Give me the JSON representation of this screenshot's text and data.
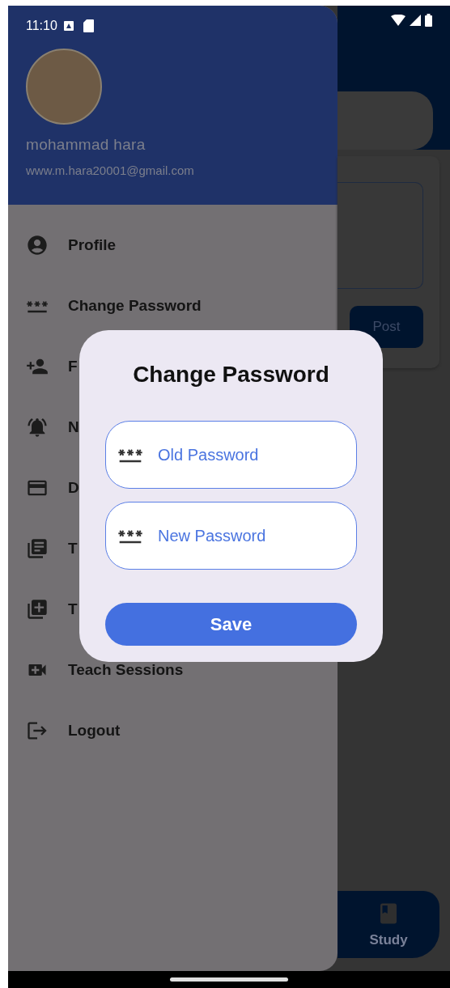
{
  "status_bar": {
    "time": "11:10"
  },
  "drawer": {
    "user": {
      "name": "mohammad hara",
      "email": "www.m.hara20001@gmail.com"
    },
    "items": [
      {
        "kind": "profile",
        "label": "Profile"
      },
      {
        "kind": "password",
        "label": "Change Password"
      },
      {
        "kind": "add_person",
        "label": "F"
      },
      {
        "kind": "alarm",
        "label": "N"
      },
      {
        "kind": "card",
        "label": "D"
      },
      {
        "kind": "articles",
        "label": "T"
      },
      {
        "kind": "add_box",
        "label": "T"
      },
      {
        "kind": "video",
        "label": "Teach Sessions"
      },
      {
        "kind": "logout",
        "label": "Logout"
      }
    ]
  },
  "background": {
    "post_button": "Post",
    "nav_item": "Study"
  },
  "dialog": {
    "title": "Change Password",
    "fields": [
      {
        "placeholder": "Old Password"
      },
      {
        "placeholder": "New Password"
      }
    ],
    "button": "Save"
  }
}
